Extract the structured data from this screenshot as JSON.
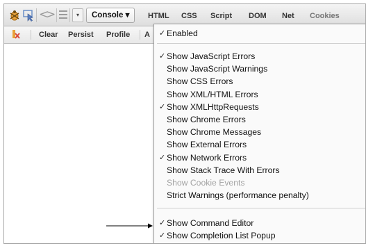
{
  "toolbar": {
    "tabs": [
      "Console",
      "HTML",
      "CSS",
      "Script",
      "DOM",
      "Net",
      "Cookies"
    ],
    "console_dropdown_symbol": "▾",
    "back_symbol": "<",
    "forward_symbol": ">"
  },
  "console_toolbar": {
    "buttons": [
      "Clear",
      "Persist",
      "Profile"
    ],
    "partial_button": "A"
  },
  "menu": {
    "enabled": {
      "label": "Enabled",
      "checked": true
    },
    "items": [
      {
        "label": "Show JavaScript Errors",
        "checked": true
      },
      {
        "label": "Show JavaScript Warnings",
        "checked": false
      },
      {
        "label": "Show CSS Errors",
        "checked": false
      },
      {
        "label": "Show XML/HTML Errors",
        "checked": false
      },
      {
        "label": "Show XMLHttpRequests",
        "checked": true
      },
      {
        "label": "Show Chrome Errors",
        "checked": false
      },
      {
        "label": "Show Chrome Messages",
        "checked": false
      },
      {
        "label": "Show External Errors",
        "checked": false
      },
      {
        "label": "Show Network Errors",
        "checked": true
      },
      {
        "label": "Show Stack Trace With Errors",
        "checked": false
      },
      {
        "label": "Show Cookie Events",
        "checked": false,
        "disabled": true
      },
      {
        "label": "Strict Warnings (performance penalty)",
        "checked": false
      }
    ],
    "bottom_items": [
      {
        "label": "Show Command Editor",
        "checked": true
      },
      {
        "label": "Show Completion List Popup",
        "checked": true
      }
    ],
    "check_symbol": "✓"
  },
  "colors": {
    "menu_bg": "#fafafa",
    "disabled_text": "#a3a3a3",
    "firebug_orange": "#e8a23a",
    "inspect_blue": "#6a8fc7",
    "clear_icon_red": "#d94a3a"
  }
}
